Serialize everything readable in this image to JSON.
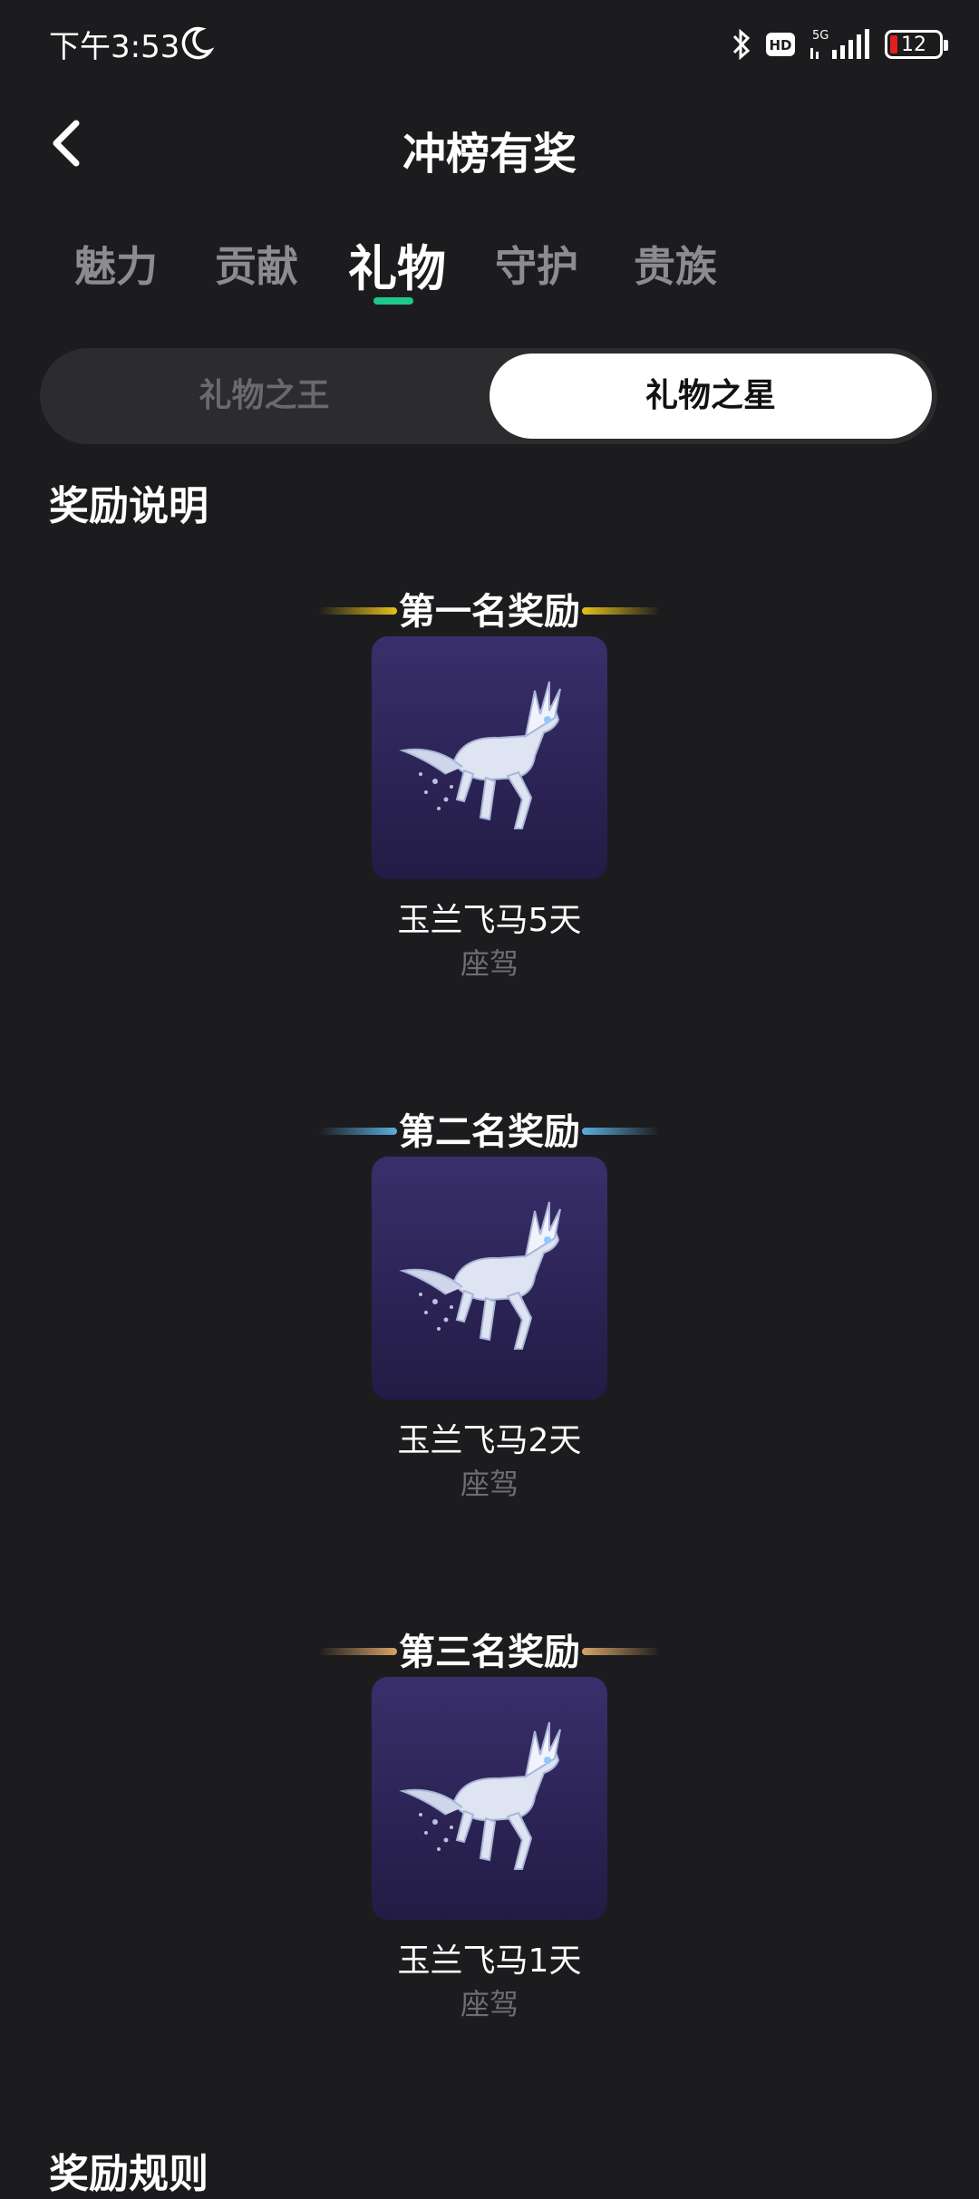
{
  "status_bar": {
    "time": "下午3:53",
    "network": "5G",
    "hd_badge": "HD",
    "battery_level": "12"
  },
  "header": {
    "title": "冲榜有奖",
    "back_icon": "chevron-left-icon"
  },
  "tabs": [
    {
      "label": "魅力",
      "active": false
    },
    {
      "label": "贡献",
      "active": false
    },
    {
      "label": "礼物",
      "active": true
    },
    {
      "label": "守护",
      "active": false
    },
    {
      "label": "贵族",
      "active": false
    }
  ],
  "segmented": {
    "left": "礼物之王",
    "right": "礼物之星",
    "selected": "礼物之星"
  },
  "reward_section": {
    "title": "奖励说明",
    "rewards": [
      {
        "heading": "第一名奖励",
        "name": "玉兰飞马5天",
        "type": "座驾",
        "accent": "#e8c21a",
        "icon": "pegasus-icon"
      },
      {
        "heading": "第二名奖励",
        "name": "玉兰飞马2天",
        "type": "座驾",
        "accent": "#5aaee0",
        "icon": "pegasus-icon"
      },
      {
        "heading": "第三名奖励",
        "name": "玉兰飞马1天",
        "type": "座驾",
        "accent": "#d8a468",
        "icon": "pegasus-icon"
      }
    ]
  },
  "rules_section": {
    "title": "奖励规则"
  },
  "colors": {
    "background": "#1c1c1e",
    "tab_indicator": "#1fc88a"
  }
}
